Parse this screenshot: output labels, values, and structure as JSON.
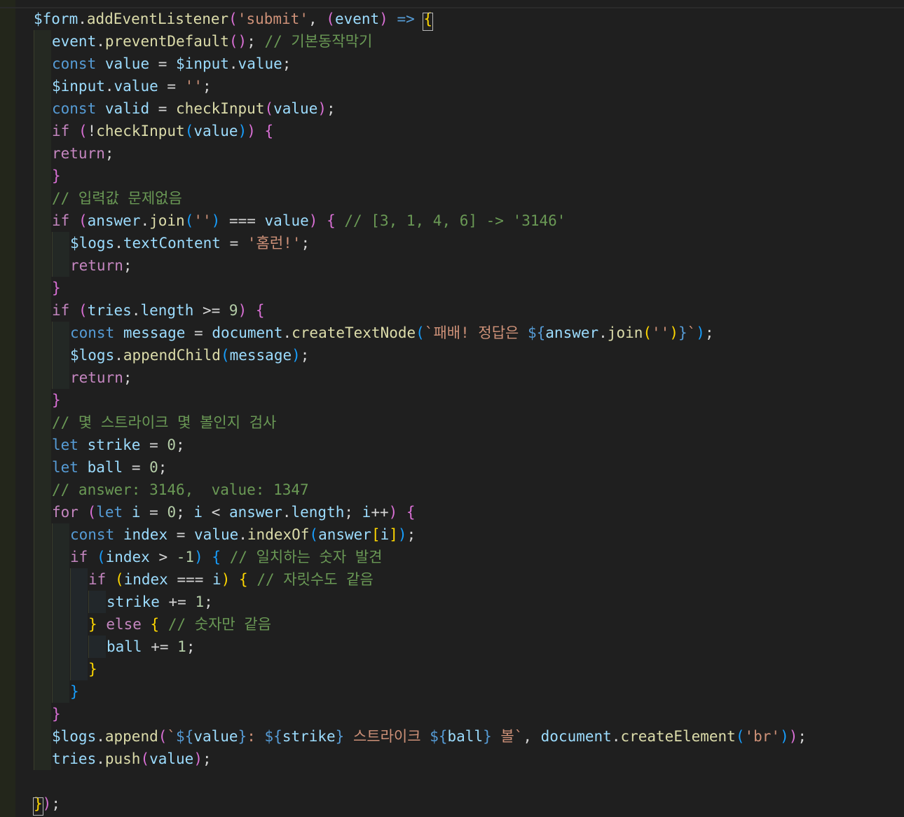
{
  "colors": {
    "background": "#1f1f1f",
    "keyword": "#569cd6",
    "control": "#c586c0",
    "variable": "#9cdcfe",
    "property": "#9cdcfe",
    "function": "#dcdcaa",
    "string": "#ce9178",
    "comment": "#6a9955",
    "number": "#b5cea8",
    "plain": "#d4d4d4",
    "bracket1": "#ffd700",
    "bracket2": "#da70d6",
    "bracket3": "#179fff"
  },
  "code": {
    "lines": [
      {
        "indent": 0,
        "tokens": [
          [
            "$form",
            "variable"
          ],
          [
            ".",
            "plain"
          ],
          [
            "addEventListener",
            "function"
          ],
          [
            "(",
            "bracket2"
          ],
          [
            "'submit'",
            "string"
          ],
          [
            ", ",
            "plain"
          ],
          [
            "(",
            "bracket2"
          ],
          [
            "event",
            "variable"
          ],
          [
            ")",
            "bracket2"
          ],
          [
            " ",
            "plain"
          ],
          [
            "=>",
            "keyword"
          ],
          [
            " ",
            "plain"
          ],
          [
            "{",
            "bracket1"
          ]
        ]
      },
      {
        "indent": 1,
        "tokens": [
          [
            "event",
            "variable"
          ],
          [
            ".",
            "plain"
          ],
          [
            "preventDefault",
            "function"
          ],
          [
            "()",
            "bracket2"
          ],
          [
            "; ",
            "plain"
          ],
          [
            "// 기본동작막기",
            "comment"
          ]
        ]
      },
      {
        "indent": 1,
        "tokens": [
          [
            "const",
            "keyword"
          ],
          [
            " ",
            "plain"
          ],
          [
            "value",
            "variable"
          ],
          [
            " = ",
            "plain"
          ],
          [
            "$input",
            "variable"
          ],
          [
            ".",
            "plain"
          ],
          [
            "value",
            "property"
          ],
          [
            ";",
            "plain"
          ]
        ]
      },
      {
        "indent": 1,
        "tokens": [
          [
            "$input",
            "variable"
          ],
          [
            ".",
            "plain"
          ],
          [
            "value",
            "property"
          ],
          [
            " = ",
            "plain"
          ],
          [
            "''",
            "string"
          ],
          [
            ";",
            "plain"
          ]
        ]
      },
      {
        "indent": 1,
        "tokens": [
          [
            "const",
            "keyword"
          ],
          [
            " ",
            "plain"
          ],
          [
            "valid",
            "variable"
          ],
          [
            " = ",
            "plain"
          ],
          [
            "checkInput",
            "function"
          ],
          [
            "(",
            "bracket2"
          ],
          [
            "value",
            "variable"
          ],
          [
            ")",
            "bracket2"
          ],
          [
            ";",
            "plain"
          ]
        ]
      },
      {
        "indent": 1,
        "tokens": [
          [
            "if",
            "control"
          ],
          [
            " ",
            "plain"
          ],
          [
            "(",
            "bracket2"
          ],
          [
            "!",
            "plain"
          ],
          [
            "checkInput",
            "function"
          ],
          [
            "(",
            "bracket3"
          ],
          [
            "value",
            "variable"
          ],
          [
            ")",
            "bracket3"
          ],
          [
            ")",
            "bracket2"
          ],
          [
            " ",
            "plain"
          ],
          [
            "{",
            "bracket2"
          ]
        ]
      },
      {
        "indent": 1,
        "tokens": [
          [
            "return",
            "control"
          ],
          [
            ";",
            "plain"
          ]
        ]
      },
      {
        "indent": 1,
        "tokens": [
          [
            "}",
            "bracket2"
          ]
        ]
      },
      {
        "indent": 1,
        "tokens": [
          [
            "// 입력값 문제없음",
            "comment"
          ]
        ]
      },
      {
        "indent": 1,
        "tokens": [
          [
            "if",
            "control"
          ],
          [
            " ",
            "plain"
          ],
          [
            "(",
            "bracket2"
          ],
          [
            "answer",
            "variable"
          ],
          [
            ".",
            "plain"
          ],
          [
            "join",
            "function"
          ],
          [
            "(",
            "bracket3"
          ],
          [
            "''",
            "string"
          ],
          [
            ")",
            "bracket3"
          ],
          [
            " === ",
            "plain"
          ],
          [
            "value",
            "variable"
          ],
          [
            ")",
            "bracket2"
          ],
          [
            " ",
            "plain"
          ],
          [
            "{",
            "bracket2"
          ],
          [
            " ",
            "plain"
          ],
          [
            "// [3, 1, 4, 6] -> '3146'",
            "comment"
          ]
        ]
      },
      {
        "indent": 2,
        "tokens": [
          [
            "$logs",
            "variable"
          ],
          [
            ".",
            "plain"
          ],
          [
            "textContent",
            "property"
          ],
          [
            " = ",
            "plain"
          ],
          [
            "'홈런!'",
            "string"
          ],
          [
            ";",
            "plain"
          ]
        ]
      },
      {
        "indent": 2,
        "tokens": [
          [
            "return",
            "control"
          ],
          [
            ";",
            "plain"
          ]
        ]
      },
      {
        "indent": 1,
        "tokens": [
          [
            "}",
            "bracket2"
          ]
        ]
      },
      {
        "indent": 1,
        "tokens": [
          [
            "if",
            "control"
          ],
          [
            " ",
            "plain"
          ],
          [
            "(",
            "bracket2"
          ],
          [
            "tries",
            "variable"
          ],
          [
            ".",
            "plain"
          ],
          [
            "length",
            "property"
          ],
          [
            " >= ",
            "plain"
          ],
          [
            "9",
            "number"
          ],
          [
            ")",
            "bracket2"
          ],
          [
            " ",
            "plain"
          ],
          [
            "{",
            "bracket2"
          ]
        ]
      },
      {
        "indent": 2,
        "tokens": [
          [
            "const",
            "keyword"
          ],
          [
            " ",
            "plain"
          ],
          [
            "message",
            "variable"
          ],
          [
            " = ",
            "plain"
          ],
          [
            "document",
            "variable"
          ],
          [
            ".",
            "plain"
          ],
          [
            "createTextNode",
            "function"
          ],
          [
            "(",
            "bracket3"
          ],
          [
            "`패배! 정답은 ",
            "string"
          ],
          [
            "${",
            "keyword"
          ],
          [
            "answer",
            "variable"
          ],
          [
            ".",
            "plain"
          ],
          [
            "join",
            "function"
          ],
          [
            "(",
            "bracket1"
          ],
          [
            "''",
            "string"
          ],
          [
            ")",
            "bracket1"
          ],
          [
            "}",
            "keyword"
          ],
          [
            "`",
            "string"
          ],
          [
            ")",
            "bracket3"
          ],
          [
            ";",
            "plain"
          ]
        ]
      },
      {
        "indent": 2,
        "tokens": [
          [
            "$logs",
            "variable"
          ],
          [
            ".",
            "plain"
          ],
          [
            "appendChild",
            "function"
          ],
          [
            "(",
            "bracket3"
          ],
          [
            "message",
            "variable"
          ],
          [
            ")",
            "bracket3"
          ],
          [
            ";",
            "plain"
          ]
        ]
      },
      {
        "indent": 2,
        "tokens": [
          [
            "return",
            "control"
          ],
          [
            ";",
            "plain"
          ]
        ]
      },
      {
        "indent": 1,
        "tokens": [
          [
            "}",
            "bracket2"
          ]
        ]
      },
      {
        "indent": 1,
        "tokens": [
          [
            "// 몇 스트라이크 몇 볼인지 검사",
            "comment"
          ]
        ]
      },
      {
        "indent": 1,
        "tokens": [
          [
            "let",
            "keyword"
          ],
          [
            " ",
            "plain"
          ],
          [
            "strike",
            "variable"
          ],
          [
            " = ",
            "plain"
          ],
          [
            "0",
            "number"
          ],
          [
            ";",
            "plain"
          ]
        ]
      },
      {
        "indent": 1,
        "tokens": [
          [
            "let",
            "keyword"
          ],
          [
            " ",
            "plain"
          ],
          [
            "ball",
            "variable"
          ],
          [
            " = ",
            "plain"
          ],
          [
            "0",
            "number"
          ],
          [
            ";",
            "plain"
          ]
        ]
      },
      {
        "indent": 1,
        "tokens": [
          [
            "// answer: 3146,  value: 1347",
            "comment"
          ]
        ]
      },
      {
        "indent": 1,
        "tokens": [
          [
            "for",
            "control"
          ],
          [
            " ",
            "plain"
          ],
          [
            "(",
            "bracket2"
          ],
          [
            "let",
            "keyword"
          ],
          [
            " ",
            "plain"
          ],
          [
            "i",
            "variable"
          ],
          [
            " = ",
            "plain"
          ],
          [
            "0",
            "number"
          ],
          [
            "; ",
            "plain"
          ],
          [
            "i",
            "variable"
          ],
          [
            " < ",
            "plain"
          ],
          [
            "answer",
            "variable"
          ],
          [
            ".",
            "plain"
          ],
          [
            "length",
            "property"
          ],
          [
            "; ",
            "plain"
          ],
          [
            "i",
            "variable"
          ],
          [
            "++",
            "plain"
          ],
          [
            ")",
            "bracket2"
          ],
          [
            " ",
            "plain"
          ],
          [
            "{",
            "bracket2"
          ]
        ]
      },
      {
        "indent": 2,
        "tokens": [
          [
            "const",
            "keyword"
          ],
          [
            " ",
            "plain"
          ],
          [
            "index",
            "variable"
          ],
          [
            " = ",
            "plain"
          ],
          [
            "value",
            "variable"
          ],
          [
            ".",
            "plain"
          ],
          [
            "indexOf",
            "function"
          ],
          [
            "(",
            "bracket3"
          ],
          [
            "answer",
            "variable"
          ],
          [
            "[",
            "bracket1"
          ],
          [
            "i",
            "variable"
          ],
          [
            "]",
            "bracket1"
          ],
          [
            ")",
            "bracket3"
          ],
          [
            ";",
            "plain"
          ]
        ]
      },
      {
        "indent": 2,
        "tokens": [
          [
            "if",
            "control"
          ],
          [
            " ",
            "plain"
          ],
          [
            "(",
            "bracket3"
          ],
          [
            "index",
            "variable"
          ],
          [
            " > ",
            "plain"
          ],
          [
            "-1",
            "number"
          ],
          [
            ")",
            "bracket3"
          ],
          [
            " ",
            "plain"
          ],
          [
            "{",
            "bracket3"
          ],
          [
            " ",
            "plain"
          ],
          [
            "// 일치하는 숫자 발견",
            "comment"
          ]
        ]
      },
      {
        "indent": 3,
        "tokens": [
          [
            "if",
            "control"
          ],
          [
            " ",
            "plain"
          ],
          [
            "(",
            "bracket1"
          ],
          [
            "index",
            "variable"
          ],
          [
            " === ",
            "plain"
          ],
          [
            "i",
            "variable"
          ],
          [
            ")",
            "bracket1"
          ],
          [
            " ",
            "plain"
          ],
          [
            "{",
            "bracket1"
          ],
          [
            " ",
            "plain"
          ],
          [
            "// 자릿수도 같음",
            "comment"
          ]
        ]
      },
      {
        "indent": 4,
        "tokens": [
          [
            "strike",
            "variable"
          ],
          [
            " += ",
            "plain"
          ],
          [
            "1",
            "number"
          ],
          [
            ";",
            "plain"
          ]
        ]
      },
      {
        "indent": 3,
        "tokens": [
          [
            "}",
            "bracket1"
          ],
          [
            " ",
            "plain"
          ],
          [
            "else",
            "control"
          ],
          [
            " ",
            "plain"
          ],
          [
            "{",
            "bracket1"
          ],
          [
            " ",
            "plain"
          ],
          [
            "// 숫자만 같음",
            "comment"
          ]
        ]
      },
      {
        "indent": 4,
        "tokens": [
          [
            "ball",
            "variable"
          ],
          [
            " += ",
            "plain"
          ],
          [
            "1",
            "number"
          ],
          [
            ";",
            "plain"
          ]
        ]
      },
      {
        "indent": 3,
        "tokens": [
          [
            "}",
            "bracket1"
          ]
        ]
      },
      {
        "indent": 2,
        "tokens": [
          [
            "}",
            "bracket3"
          ]
        ]
      },
      {
        "indent": 1,
        "tokens": [
          [
            "}",
            "bracket2"
          ]
        ]
      },
      {
        "indent": 1,
        "tokens": [
          [
            "$logs",
            "variable"
          ],
          [
            ".",
            "plain"
          ],
          [
            "append",
            "function"
          ],
          [
            "(",
            "bracket2"
          ],
          [
            "`",
            "string"
          ],
          [
            "${",
            "keyword"
          ],
          [
            "value",
            "variable"
          ],
          [
            "}",
            "keyword"
          ],
          [
            ": ",
            "string"
          ],
          [
            "${",
            "keyword"
          ],
          [
            "strike",
            "variable"
          ],
          [
            "}",
            "keyword"
          ],
          [
            " 스트라이크 ",
            "string"
          ],
          [
            "${",
            "keyword"
          ],
          [
            "ball",
            "variable"
          ],
          [
            "}",
            "keyword"
          ],
          [
            " 볼`",
            "string"
          ],
          [
            ", ",
            "plain"
          ],
          [
            "document",
            "variable"
          ],
          [
            ".",
            "plain"
          ],
          [
            "createElement",
            "function"
          ],
          [
            "(",
            "bracket3"
          ],
          [
            "'br'",
            "string"
          ],
          [
            ")",
            "bracket3"
          ],
          [
            ")",
            "bracket2"
          ],
          [
            ";",
            "plain"
          ]
        ]
      },
      {
        "indent": 1,
        "tokens": [
          [
            "tries",
            "variable"
          ],
          [
            ".",
            "plain"
          ],
          [
            "push",
            "function"
          ],
          [
            "(",
            "bracket2"
          ],
          [
            "value",
            "variable"
          ],
          [
            ")",
            "bracket2"
          ],
          [
            ";",
            "plain"
          ]
        ]
      },
      {
        "indent": 0,
        "tokens": []
      },
      {
        "indent": 0,
        "tokens": [
          [
            "}",
            "bracket1"
          ],
          [
            ")",
            "bracket2"
          ],
          [
            ";",
            "plain"
          ]
        ]
      }
    ]
  }
}
